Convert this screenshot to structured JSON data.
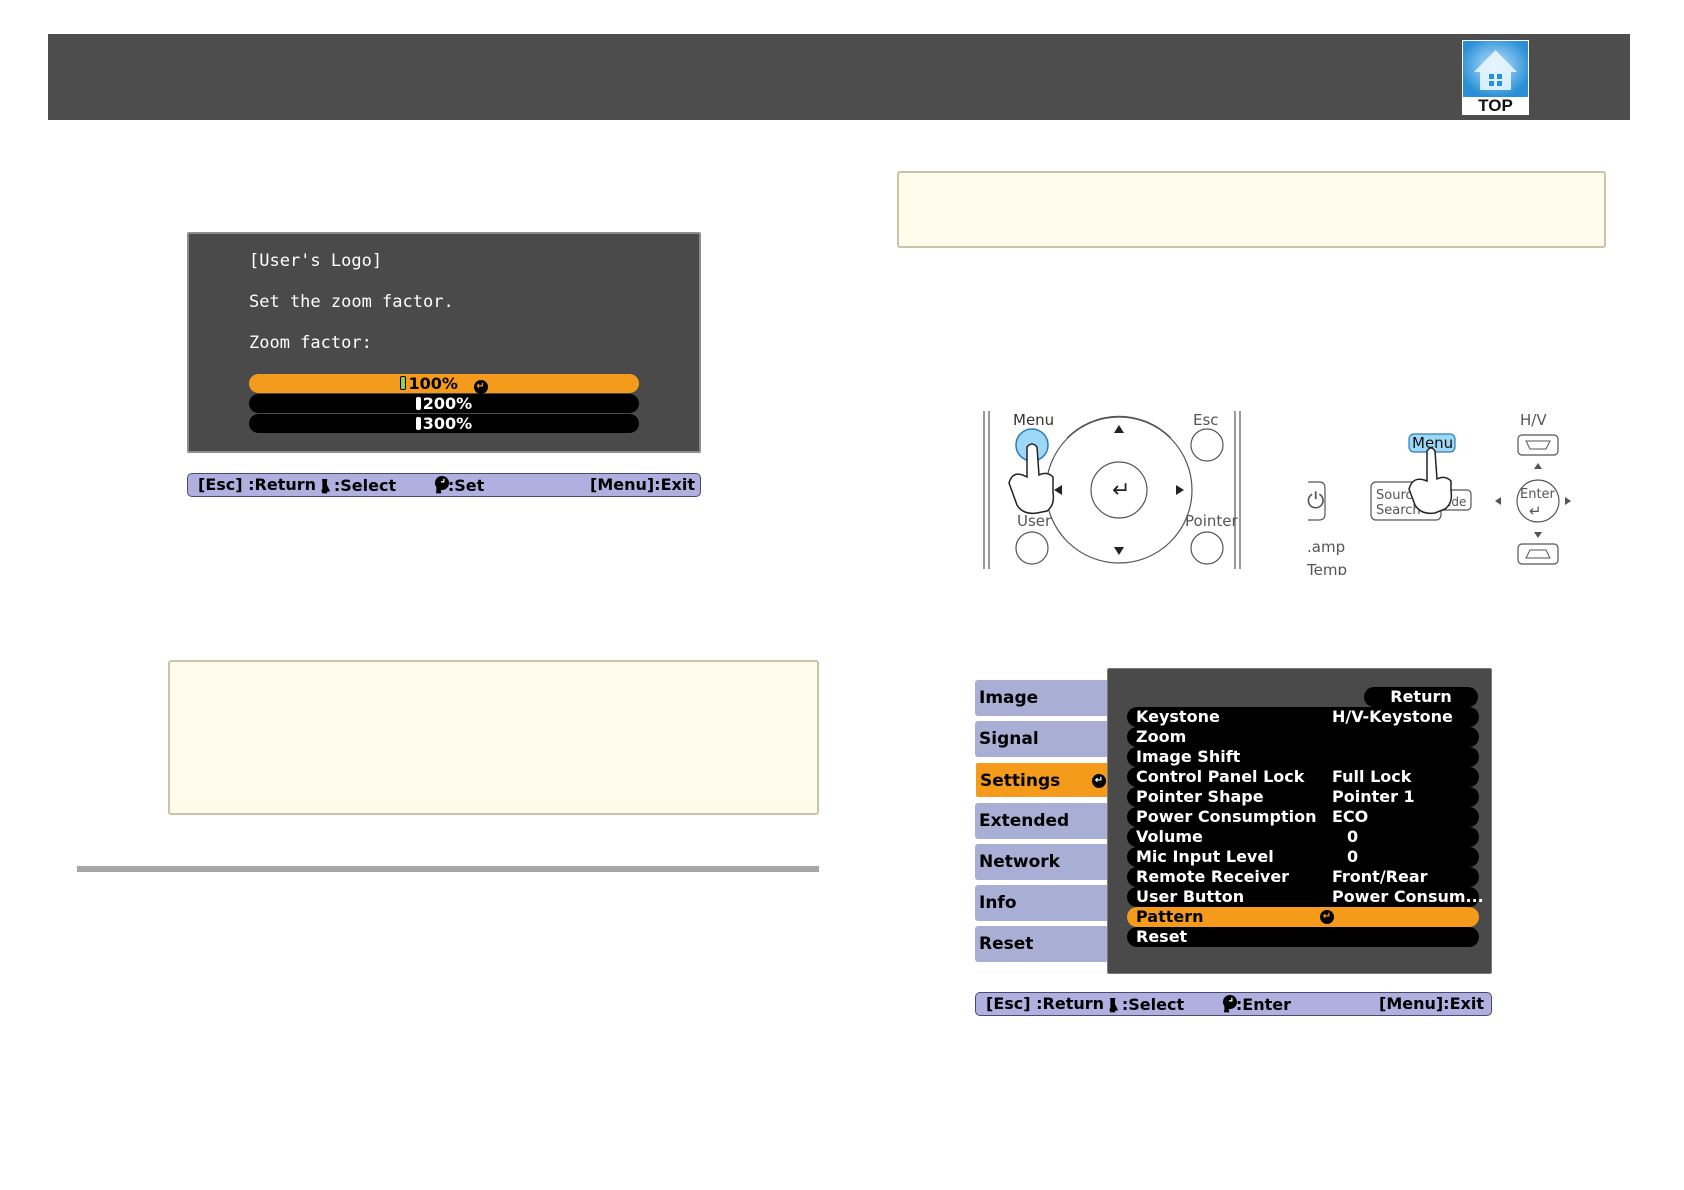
{
  "header": {
    "logo_text": "TOP"
  },
  "user_logo_dialog": {
    "title": "[User's Logo]",
    "instruction": "Set the zoom factor.",
    "label": "Zoom factor:",
    "options": [
      "100%",
      "200%",
      "300%"
    ],
    "selected_index": 0,
    "guide": {
      "return": "[Esc] :Return",
      "select_pre": "[",
      "select_post": "] :Select",
      "set_pre": "[",
      "set_post": "] :Set",
      "exit": "[Menu]:Exit"
    }
  },
  "remote": {
    "menu": "Menu",
    "esc": "Esc",
    "user": "User",
    "pointer": "Pointer",
    "panel_menu": "Menu",
    "hv": "H/V",
    "source_line1": "Source",
    "source_line2": "Search",
    "vide": "ide",
    "enter": "Enter",
    "lamp": ".amp",
    "temp": "Temp"
  },
  "settings_menu": {
    "tabs": [
      "Image",
      "Signal",
      "Settings",
      "Extended",
      "Network",
      "Info",
      "Reset"
    ],
    "active_tab": 2,
    "return_label": "Return",
    "rows": [
      {
        "label": "Keystone",
        "value": "H/V-Keystone"
      },
      {
        "label": "Zoom",
        "value": ""
      },
      {
        "label": "Image Shift",
        "value": ""
      },
      {
        "label": "Control Panel Lock",
        "value": "Full Lock"
      },
      {
        "label": "Pointer Shape",
        "value": "Pointer 1"
      },
      {
        "label": "Power Consumption",
        "value": "ECO"
      },
      {
        "label": "Volume",
        "value": "0"
      },
      {
        "label": "Mic Input Level",
        "value": "0"
      },
      {
        "label": "Remote Receiver",
        "value": "Front/Rear"
      },
      {
        "label": "User Button",
        "value": "Power Consum..."
      },
      {
        "label": "Pattern",
        "value": ""
      },
      {
        "label": "Reset",
        "value": ""
      }
    ],
    "selected_row": 10,
    "guide": {
      "return": "[Esc] :Return",
      "select_pre": "[",
      "select_post": "] :Select",
      "enter_pre": "[",
      "enter_post": "] :Enter",
      "exit": "[Menu]:Exit"
    }
  }
}
